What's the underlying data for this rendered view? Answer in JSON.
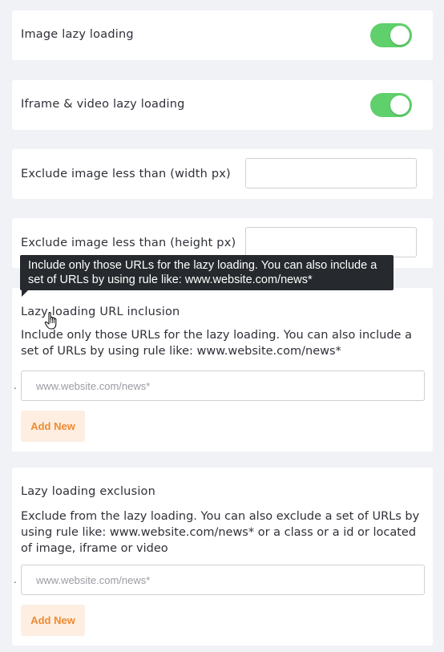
{
  "settings": {
    "image_lazy_loading": {
      "label": "Image lazy loading",
      "enabled": true
    },
    "iframe_lazy_loading": {
      "label": "Iframe & video lazy loading",
      "enabled": true
    },
    "exclude_width": {
      "label": "Exclude image less than (width px)",
      "value": ""
    },
    "exclude_height": {
      "label": "Exclude image less than (height px)",
      "value": ""
    }
  },
  "inclusion": {
    "title": "Lazy loading URL inclusion",
    "description": "Include only those URLs for the lazy loading. You can also include a set of URLs by using rule like: www.website.com/news*",
    "dot": ".",
    "input_placeholder": "www.website.com/news*",
    "add_label": "Add New"
  },
  "exclusion": {
    "title": "Lazy loading exclusion",
    "description": "Exclude from the lazy loading. You can also exclude a set of URLs by using rule like: www.website.com/news* or a class or a id or located of image, iframe or video",
    "dot": ".",
    "input_placeholder": "www.website.com/news*",
    "add_label": "Add New"
  },
  "tooltip": {
    "text": "Include only those URLs for the lazy loading. You can also include a set of URLs by using rule like: www.website.com/news*"
  },
  "icons": {
    "cursor": "hand-pointer-icon"
  },
  "colors": {
    "page_bg": "#f1f2f6",
    "toggle_on": "#5fd06c",
    "button_bg": "#fdeee1",
    "button_text": "#ee8a33",
    "tooltip_bg": "#26292d"
  }
}
